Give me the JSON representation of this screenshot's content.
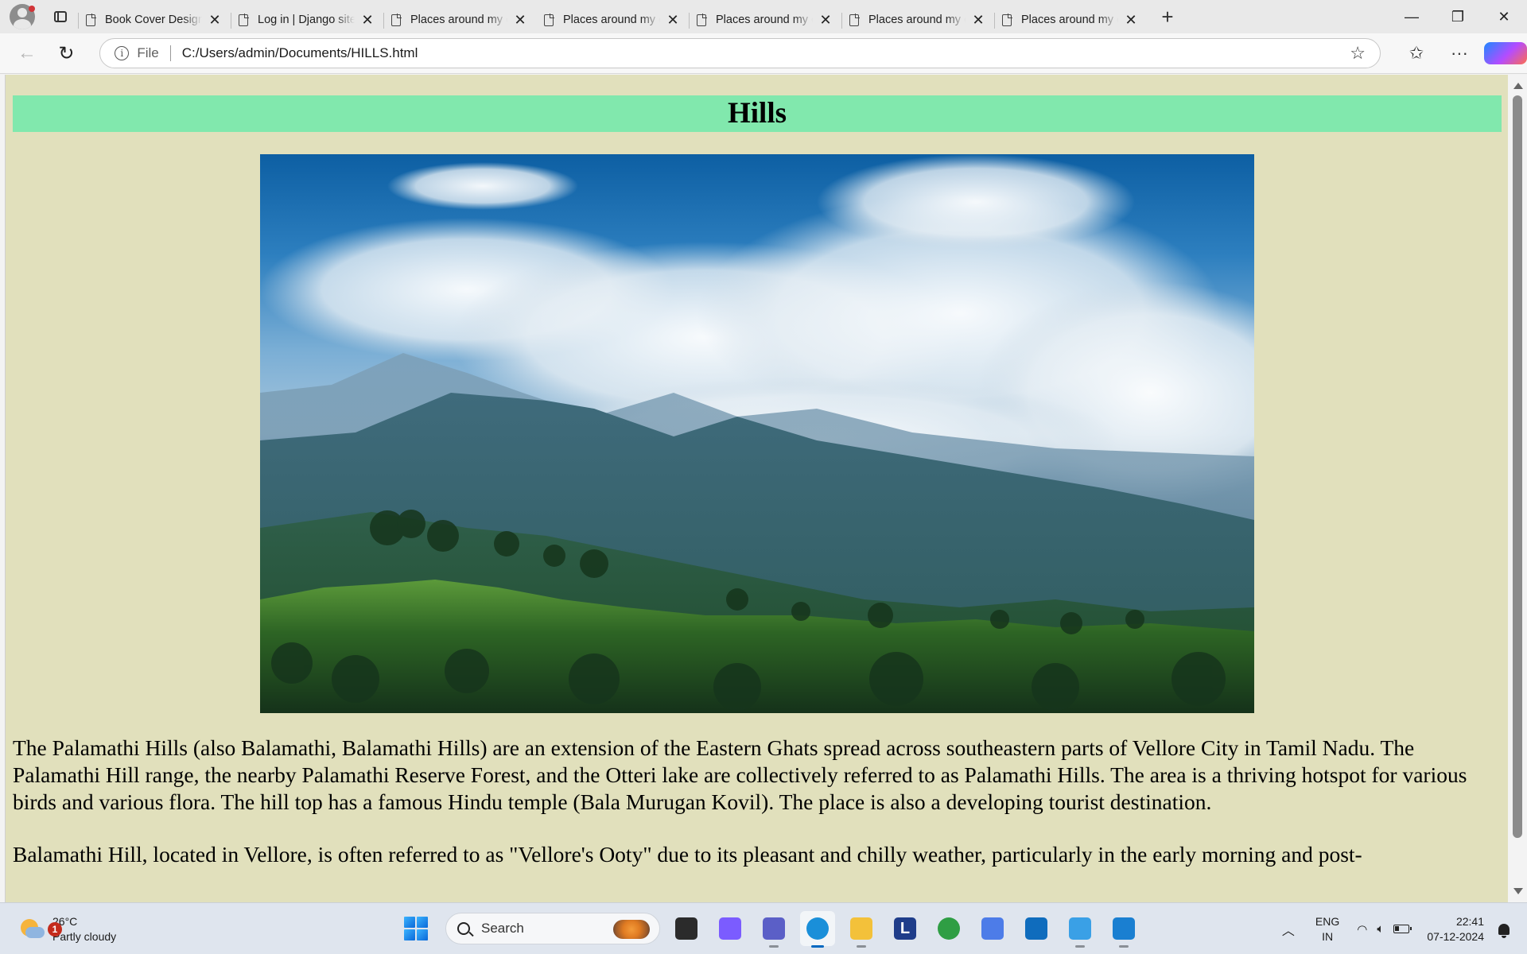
{
  "browser": {
    "tabs": [
      {
        "title": "Book Cover Design",
        "active": false
      },
      {
        "title": "Log in | Django site admin",
        "active": false
      },
      {
        "title": "Places around my city",
        "active": false
      },
      {
        "title": "Places around my city",
        "active": true
      },
      {
        "title": "Places around my city",
        "active": false
      },
      {
        "title": "Places around my city",
        "active": false
      },
      {
        "title": "Places around my city",
        "active": false
      },
      {
        "title": "Places around my city",
        "active": false
      }
    ],
    "address": {
      "scheme_label": "File",
      "url": "C:/Users/admin/Documents/HILLS.html"
    },
    "icons": {
      "new_tab": "+",
      "close": "✕",
      "minimize": "—",
      "restore": "❐",
      "window_close": "✕",
      "back": "←",
      "reload": "↻",
      "favorite": "☆",
      "favorites": "☆",
      "more": "···"
    }
  },
  "page": {
    "heading": "Hills",
    "heading_bg": "#81e8ad",
    "background": "#e1e0bc",
    "paragraphs": [
      "The Palamathi Hills (also Balamathi, Balamathi Hills) are an extension of the Eastern Ghats spread across southeastern parts of Vellore City in Tamil Nadu. The Palamathi Hill range, the nearby Palamathi Reserve Forest, and the Otteri lake are collectively referred to as Palamathi Hills. The area is a thriving hotspot for various birds and various flora. The hill top has a famous Hindu temple (Bala Murugan Kovil). The place is also a developing tourist destination.",
      "Balamathi Hill, located in Vellore, is often referred to as \"Vellore's Ooty\" due to its pleasant and chilly weather, particularly in the early morning and post-"
    ]
  },
  "taskbar": {
    "weather": {
      "temp": "26°C",
      "condition": "Partly cloudy",
      "badge": "1"
    },
    "search_label": "Search",
    "apps": [
      {
        "name": "file-explorer-black",
        "color": "#2b2b2b"
      },
      {
        "name": "copilot",
        "color": "#7b5cff"
      },
      {
        "name": "teams",
        "color": "#5b5fc7"
      },
      {
        "name": "edge",
        "color": "#1a8fd9"
      },
      {
        "name": "file-explorer",
        "color": "#f3c13a"
      },
      {
        "name": "l-app",
        "color": "#1f3d8a"
      },
      {
        "name": "chrome",
        "color": "#2f9e44"
      },
      {
        "name": "arc-app",
        "color": "#4d7ce8"
      },
      {
        "name": "microsoft-store",
        "color": "#0f6cbd"
      },
      {
        "name": "paint-app",
        "color": "#3aa0e6"
      },
      {
        "name": "vs-code",
        "color": "#1a7fd1"
      }
    ],
    "lang_line1": "ENG",
    "lang_line2": "IN",
    "time": "22:41",
    "date": "07-12-2024"
  }
}
